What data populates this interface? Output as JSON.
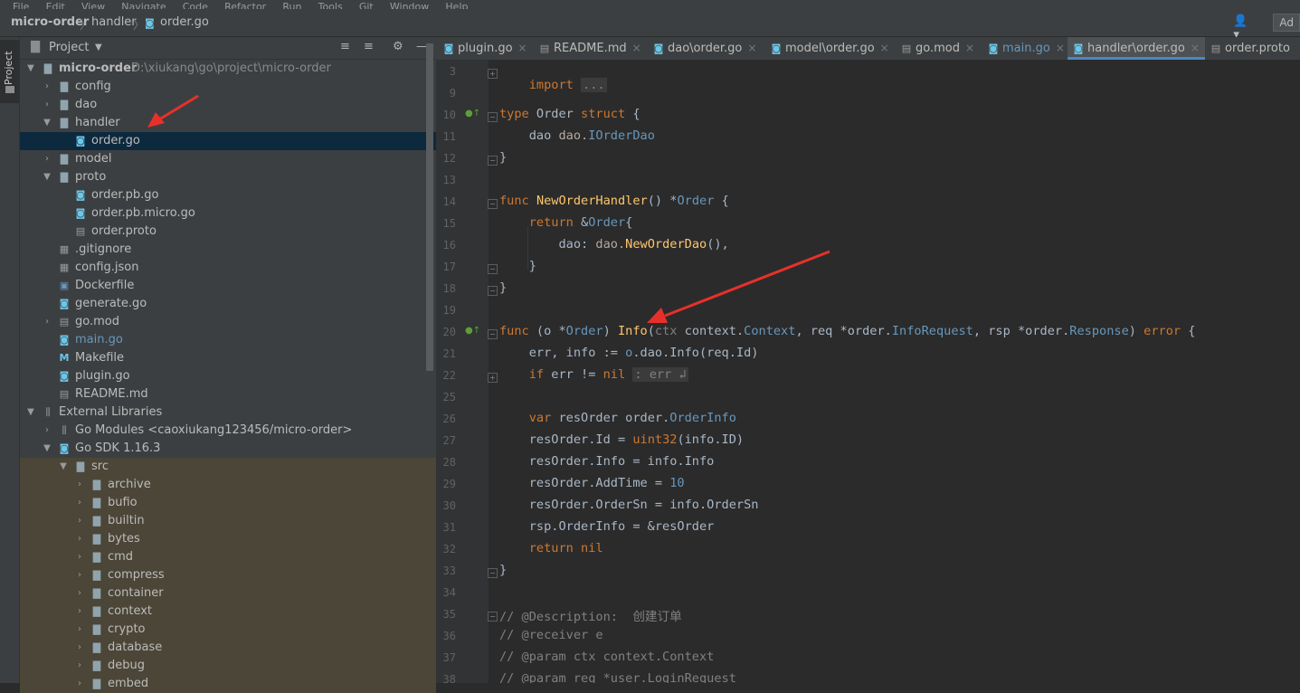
{
  "menubar": {
    "items": [
      "File",
      "Edit",
      "View",
      "Navigate",
      "Code",
      "Refactor",
      "Run",
      "Tools",
      "Git",
      "Window",
      "Help"
    ]
  },
  "navbar": {
    "project": "micro-order",
    "folder": "handler",
    "file": "order.go",
    "add_label": "Ad"
  },
  "toolstrip": {
    "project_label": "Project"
  },
  "panel": {
    "title": "Project"
  },
  "tree": {
    "root_name": "micro-order",
    "root_path": "D:\\xiukang\\go\\project\\micro-order",
    "items": [
      "config",
      "dao",
      "handler",
      "order.go",
      "model",
      "proto",
      "order.pb.go",
      "order.pb.micro.go",
      "order.proto",
      ".gitignore",
      "config.json",
      "Dockerfile",
      "generate.go",
      "go.mod",
      "main.go",
      "Makefile",
      "plugin.go",
      "README.md"
    ],
    "external_libraries": "External Libraries",
    "go_modules": "Go Modules <caoxiukang123456/micro-order>",
    "go_sdk": "Go SDK 1.16.3",
    "src": "src",
    "src_items": [
      "archive",
      "bufio",
      "builtin",
      "bytes",
      "cmd",
      "compress",
      "container",
      "context",
      "crypto",
      "database",
      "debug",
      "embed"
    ]
  },
  "tabs": [
    "plugin.go",
    "README.md",
    "dao\\order.go",
    "model\\order.go",
    "go.mod",
    "main.go",
    "handler\\order.go",
    "order.proto"
  ],
  "editor": {
    "line_numbers": [
      "3",
      "9",
      "10",
      "11",
      "12",
      "13",
      "14",
      "15",
      "16",
      "17",
      "18",
      "19",
      "20",
      "21",
      "22",
      "25",
      "26",
      "27",
      "28",
      "29",
      "30",
      "31",
      "32",
      "33",
      "34",
      "35",
      "36",
      "37",
      "38"
    ],
    "lines": {
      "l3": "import ...",
      "l10": "type Order struct {",
      "l11": "dao dao.IOrderDao",
      "l12": "}",
      "l14": "func NewOrderHandler() *Order {",
      "l15": "return &Order{",
      "l16": "dao: dao.NewOrderDao(),",
      "l17": "}",
      "l18": "}",
      "l20": "func (o *Order) Info(ctx context.Context, req *order.InfoRequest, rsp *order.Response) error {",
      "l21": "err, info := o.dao.Info(req.Id)",
      "l22": "if err != nil : err ↲",
      "l26": "var resOrder order.OrderInfo",
      "l27": "resOrder.Id = uint32(info.ID)",
      "l28": "resOrder.Info = info.Info",
      "l29": "resOrder.AddTime = 10",
      "l30": "resOrder.OrderSn = info.OrderSn",
      "l31": "rsp.OrderInfo = &resOrder",
      "l32": "return nil",
      "l33": "}",
      "l35": "// @Description:  创建订单",
      "l36": "// @receiver e",
      "l37": "// @param ctx context.Context",
      "l38": "// @param req *user.LoginRequest"
    }
  },
  "colors": {
    "keyword": "#cc7832",
    "type": "#6897bb",
    "function": "#ffc66d",
    "comment": "#808080",
    "arrow": "#e8302a",
    "selection": "#0d293e"
  }
}
